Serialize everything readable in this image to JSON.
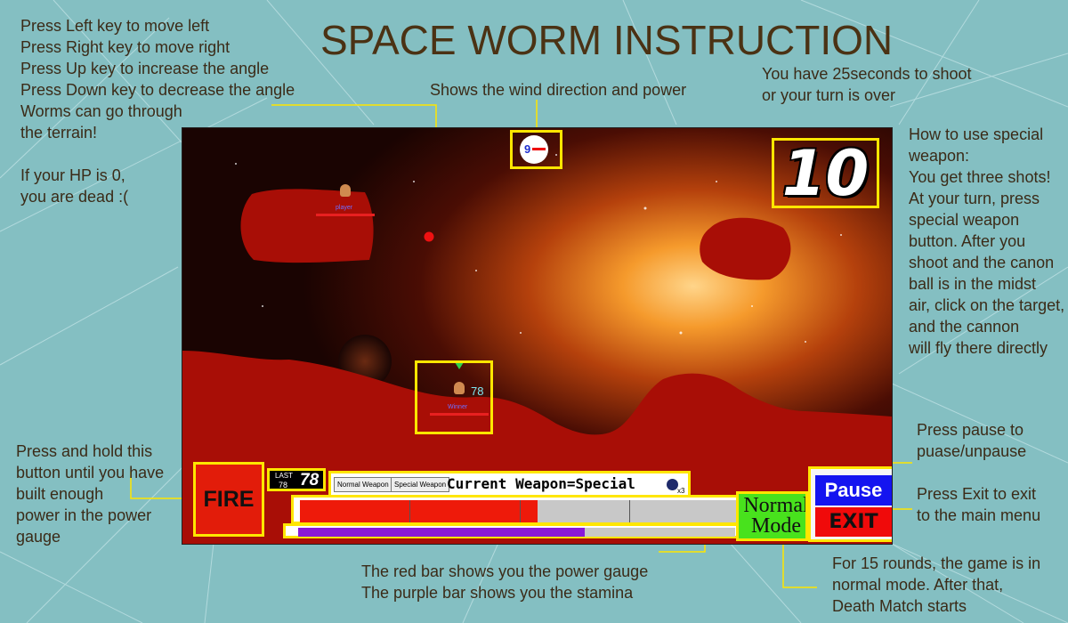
{
  "title": "SPACE WORM INSTRUCTION",
  "notes": {
    "controls": "Press Left key to move left\nPress Right key to move right\nPress Up key to increase the angle\nPress Down key to decrease the angle\nWorms can go through\nthe terrain!\n\nIf your HP is 0,\nyou are dead :(",
    "wind": "Shows the wind direction and power",
    "timer": "You have 25seconds to shoot\nor your turn is over",
    "special": "How to use special\nweapon:\nYou get three shots!\nAt your turn, press\nspecial weapon\nbutton. After you\nshoot and the canon\nball is in the midst\nair, click on the target,\nand the cannon\nwill fly there  directly",
    "fire": "Press and hold this\nbutton until you have\nbuilt enough\npower in the power\ngauge",
    "pause": "Press pause to\npuase/unpause",
    "exit": "Press Exit to exit\nto the main menu",
    "gauges": "The red bar shows you the power gauge\nThe purple bar shows you the stamina",
    "mode": "For 15 rounds, the game is in\nnormal mode. After that,\nDeath Match starts"
  },
  "game": {
    "timer": "10",
    "wind_value": "9",
    "fire_label": "FIRE",
    "last_label_top": "LAST",
    "last_label_bottom": "78",
    "last_value": "78",
    "normal_weapon_label": "Normal Weapon",
    "special_weapon_label": "Special Weapon",
    "current_weapon": "Current Weapon=Special",
    "special_count": "x3",
    "power_fraction": 0.54,
    "stamina_fraction": 0.655,
    "mode_label": "Normal Mode",
    "pause_label": "Pause",
    "exit_label": "EXIT",
    "worm1": {
      "name": "player",
      "hp": ""
    },
    "worm2": {
      "name": "Winner",
      "hp": "78"
    }
  },
  "colors": {
    "background": "#84bfc2",
    "terrain": "#a80e06",
    "highlight": "#ffe600",
    "power": "#ee1a0a",
    "stamina": "#8a18d8",
    "mode": "#48e21d",
    "pause": "#1414f0",
    "exit": "#f00a0a"
  }
}
